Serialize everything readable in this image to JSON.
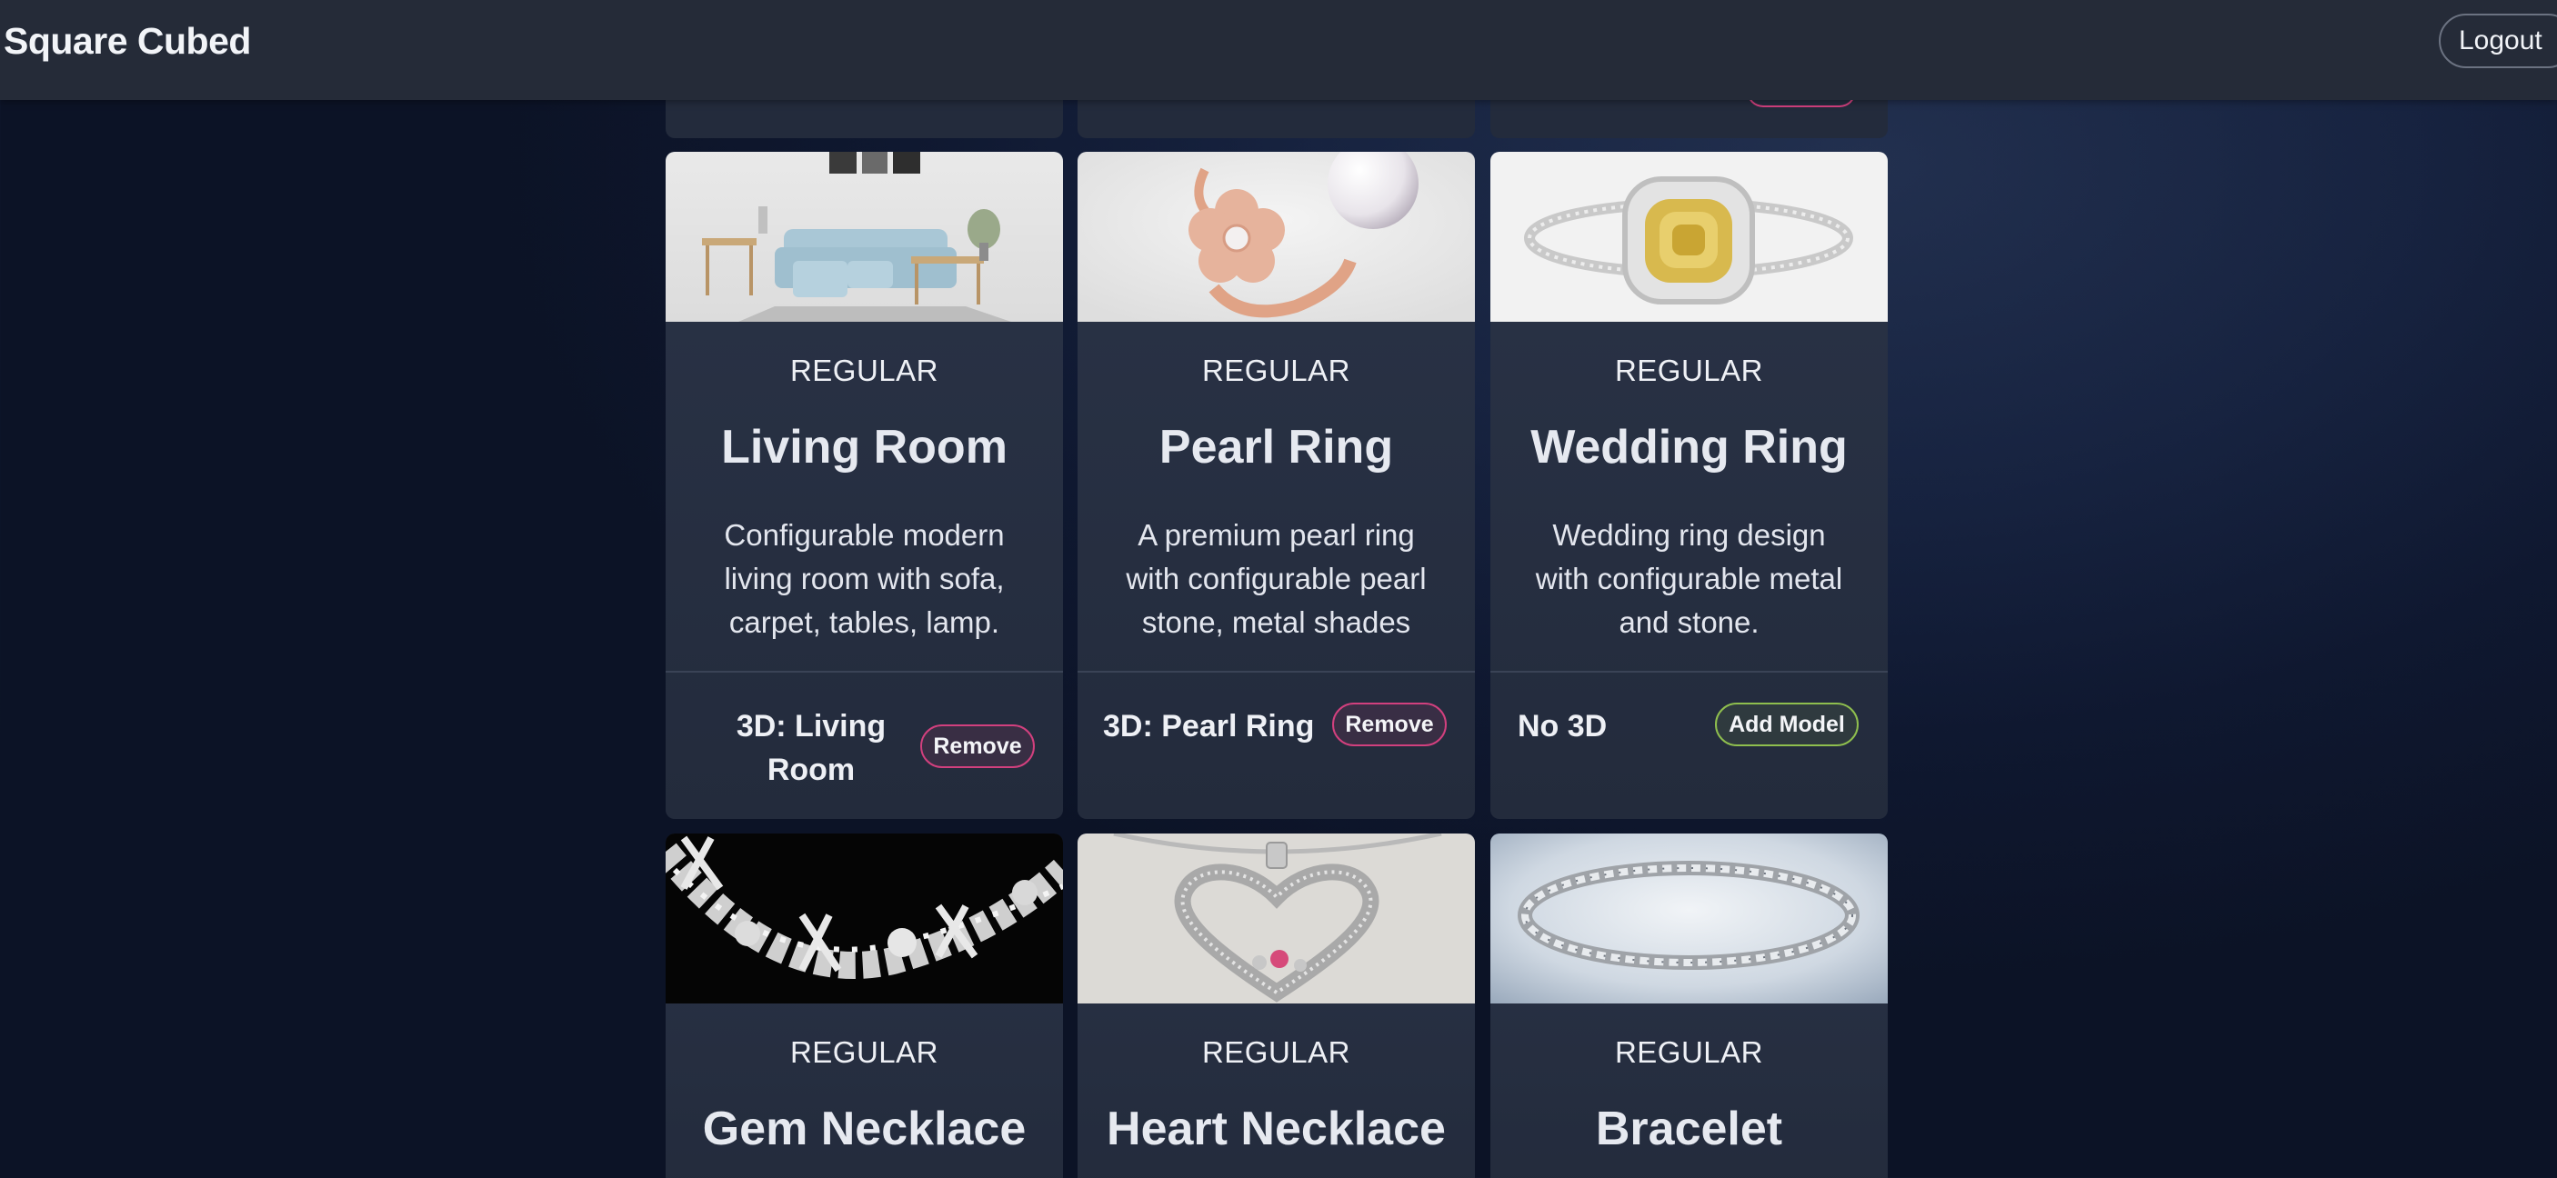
{
  "app": {
    "title": "Square Cubed",
    "logout_label": "Logout"
  },
  "cards": [
    {
      "badge": "REGULAR",
      "title": "Living Room",
      "description": "Configurable modern living room with sofa, carpet, tables, lamp.",
      "model_label": "3D: Living Room",
      "action_label": "Remove"
    },
    {
      "badge": "REGULAR",
      "title": "Pearl Ring",
      "description": "A premium pearl ring with configurable pearl stone, metal shades",
      "model_label": "3D: Pearl Ring",
      "action_label": "Remove"
    },
    {
      "badge": "REGULAR",
      "title": "Wedding Ring",
      "description": "Wedding ring design with configurable metal and stone.",
      "model_label": "No 3D",
      "action_label": "Add Model"
    },
    {
      "badge": "REGULAR",
      "title": "Gem Necklace"
    },
    {
      "badge": "REGULAR",
      "title": "Heart Necklace"
    },
    {
      "badge": "REGULAR",
      "title": "Bracelet"
    }
  ],
  "colors": {
    "remove_accent": "#d2407e",
    "add_accent": "#8fbf4e",
    "header_bg": "#252b38",
    "card_bg": "#2a3347"
  }
}
